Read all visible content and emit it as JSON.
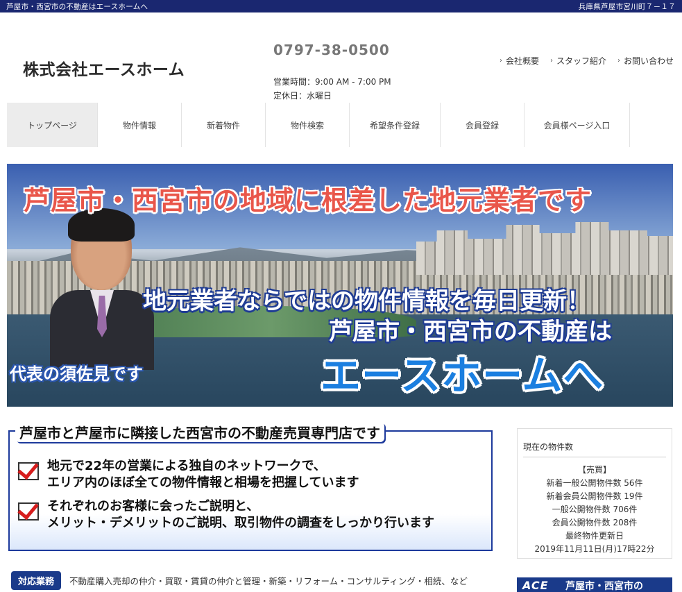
{
  "topbar": {
    "left_text": "芦屋市・西宮市の不動産はエースホームへ",
    "right_text": "兵庫県芦屋市宮川町７－１７"
  },
  "header": {
    "logo": "株式会社エースホーム",
    "phone": "0797-38-0500",
    "hours": "営業時間：9:00 AM - 7:00 PM",
    "closed": "定休日：水曜日",
    "links": [
      "会社概要",
      "スタッフ紹介",
      "お問い合わせ"
    ]
  },
  "nav": {
    "items": [
      "トップページ",
      "物件情報",
      "新着物件",
      "物件検索",
      "希望条件登録",
      "会員登録",
      "会員様ページ入口"
    ],
    "active_index": 0
  },
  "hero": {
    "headline": "芦屋市・西宮市の地域に根差した地元業者です",
    "line2": "地元業者ならではの物件情報を毎日更新！",
    "line3": "芦屋市・西宮市の不動産は",
    "line4": "エースホームへ",
    "caption": "代表の須佐見です"
  },
  "intro": {
    "heading": "芦屋市と芦屋市に隣接した西宮市の不動産売買専門店です",
    "point1_line1": "地元で22年の営業による独自のネットワークで、",
    "point1_line2": "エリア内のほぼ全ての物件情報と相場を把握しています",
    "point2_line1": "それぞれのお客様に会ったご説明と、",
    "point2_line2": "メリット・デメリットのご説明、取引物件の調査をしっかり行います"
  },
  "services": {
    "badge": "対応業務",
    "text": "不動産購入売却の仲介・買取・賃貸の仲介と管理・新築・リフォーム・コンサルティング・相続、など"
  },
  "sidebar": {
    "title": "現在の物件数",
    "section": "【売買】",
    "rows": [
      "新着一般公開物件数 56件",
      "新着会員公開物件数 19件",
      "一般公開物件数 706件",
      "会員公開物件数 208件",
      "最終物件更新日",
      "2019年11月11日(月)17時22分"
    ]
  },
  "banner": {
    "logo_text": "ACE",
    "text": "芦屋市・西宮市の"
  },
  "colors": {
    "navy": "#1a2770",
    "accent_blue": "#1b7fe0",
    "headline_red": "#e9564a",
    "check_red": "#d71d1d"
  }
}
